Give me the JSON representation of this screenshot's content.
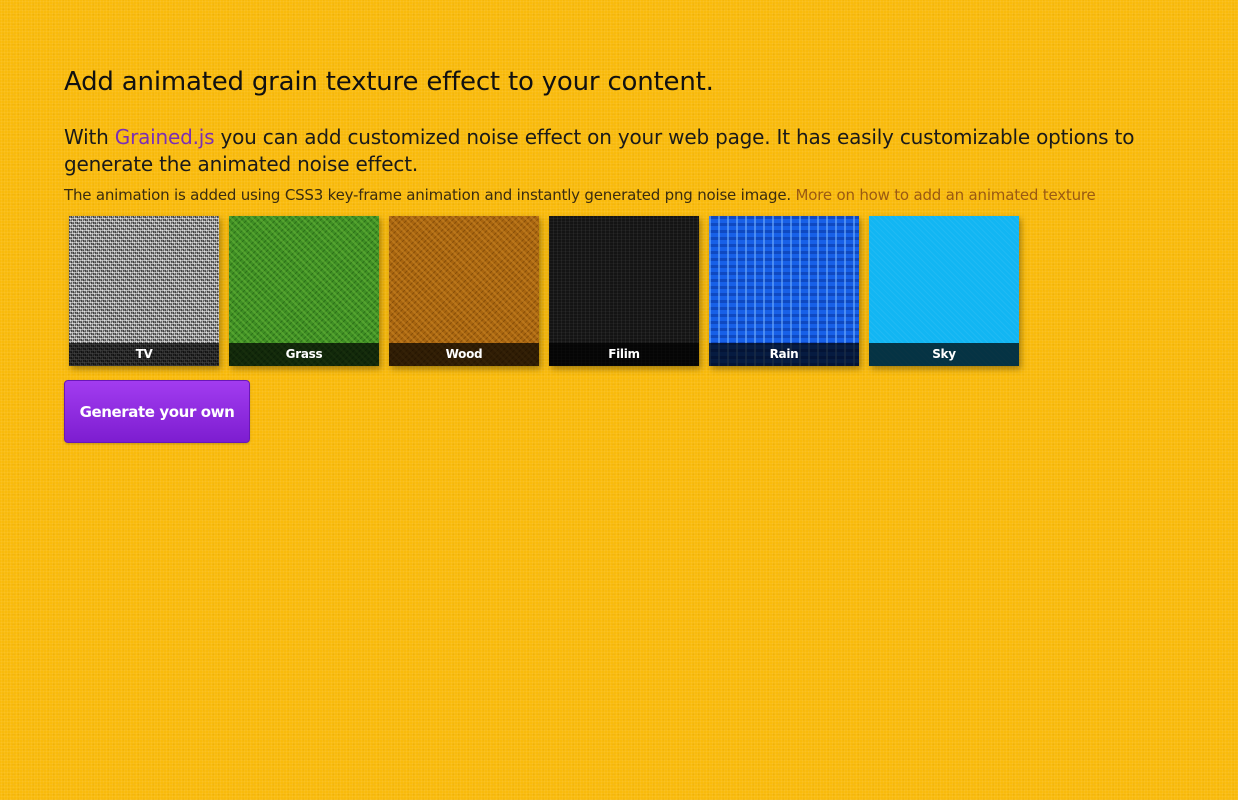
{
  "headline": "Add animated grain texture effect to your content.",
  "intro": {
    "prefix": "With ",
    "link_text": "Grained.js",
    "suffix": " you can add customized noise effect on your web page. It has easily customizable options to generate the animated noise effect."
  },
  "note": {
    "text": "The animation is added using CSS3 key-frame animation and instantly generated png noise image. ",
    "link_text": "More on how to add an animated texture"
  },
  "presets": [
    {
      "label": "TV",
      "color": "#9a9a9a"
    },
    {
      "label": "Grass",
      "color": "#3f8f24"
    },
    {
      "label": "Wood",
      "color": "#a8650f"
    },
    {
      "label": "Filim",
      "color": "#141414"
    },
    {
      "label": "Rain",
      "color": "#1760e8"
    },
    {
      "label": "Sky",
      "color": "#12b6f3"
    }
  ],
  "generate_button": "Generate your own",
  "colors": {
    "background": "#f9bb0c",
    "link": "#7b2fb5",
    "secondary_link": "#9b5a12",
    "button": "#8a2be2"
  }
}
